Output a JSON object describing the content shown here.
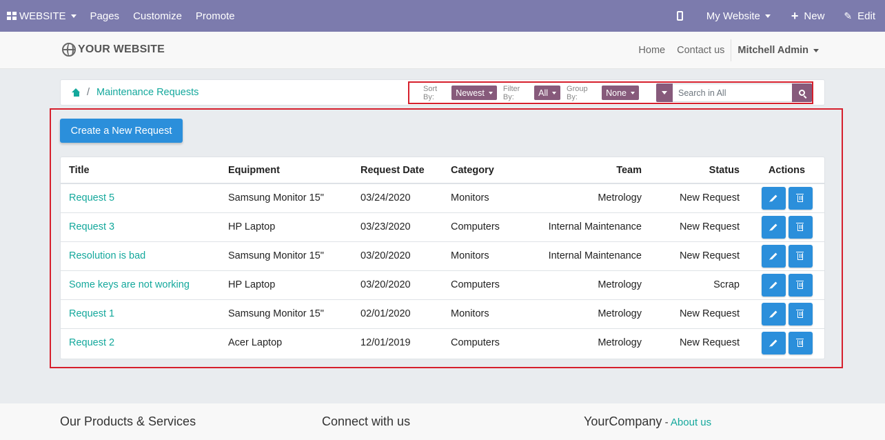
{
  "topbar": {
    "website_label": "WEBSITE",
    "menu": [
      "Pages",
      "Customize",
      "Promote"
    ],
    "site_selector": "My Website",
    "new_label": "New",
    "edit_label": "Edit"
  },
  "header": {
    "logo_text": "YOUR WEBSITE",
    "nav": [
      "Home",
      "Contact us"
    ],
    "user": "Mitchell Admin"
  },
  "breadcrumb": {
    "sep": "/",
    "current": "Maintenance Requests"
  },
  "controls": {
    "sort_label": "Sort By:",
    "sort_value": "Newest",
    "filter_label": "Filter By:",
    "filter_value": "All",
    "group_label": "Group By:",
    "group_value": "None",
    "search_placeholder": "Search in All"
  },
  "main": {
    "create_label": "Create a New Request"
  },
  "table": {
    "headers": {
      "title": "Title",
      "equipment": "Equipment",
      "date": "Request Date",
      "category": "Category",
      "team": "Team",
      "status": "Status",
      "actions": "Actions"
    },
    "rows": [
      {
        "title": "Request 5",
        "equipment": "Samsung Monitor 15\"",
        "date": "03/24/2020",
        "category": "Monitors",
        "team": "Metrology",
        "status": "New Request"
      },
      {
        "title": "Request 3",
        "equipment": "HP Laptop",
        "date": "03/23/2020",
        "category": "Computers",
        "team": "Internal Maintenance",
        "status": "New Request"
      },
      {
        "title": "Resolution is bad",
        "equipment": "Samsung Monitor 15\"",
        "date": "03/20/2020",
        "category": "Monitors",
        "team": "Internal Maintenance",
        "status": "New Request"
      },
      {
        "title": "Some keys are not working",
        "equipment": "HP Laptop",
        "date": "03/20/2020",
        "category": "Computers",
        "team": "Metrology",
        "status": "Scrap"
      },
      {
        "title": "Request 1",
        "equipment": "Samsung Monitor 15\"",
        "date": "02/01/2020",
        "category": "Monitors",
        "team": "Metrology",
        "status": "New Request"
      },
      {
        "title": "Request 2",
        "equipment": "Acer Laptop",
        "date": "12/01/2019",
        "category": "Computers",
        "team": "Metrology",
        "status": "New Request"
      }
    ]
  },
  "footer": {
    "col1_title": "Our Products & Services",
    "col2_title": "Connect with us",
    "col3_title": "YourCompany",
    "col3_dash": " - ",
    "col3_link": "About us"
  }
}
